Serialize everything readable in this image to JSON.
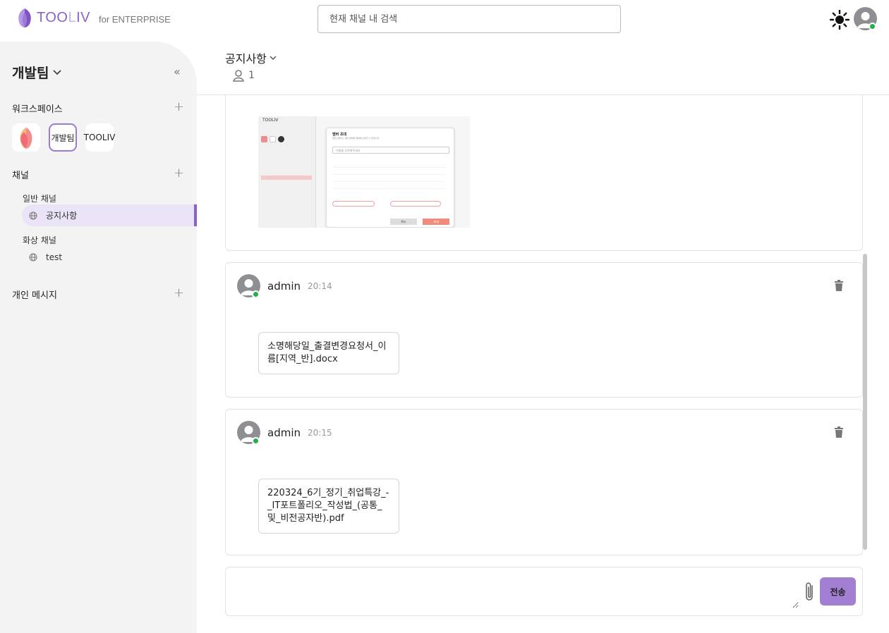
{
  "app": {
    "logo_text_main": "TOO",
    "logo_text_dim": "L",
    "logo_text_end": "IV",
    "logo_sub": "for ENTERPRISE"
  },
  "search": {
    "placeholder": "현재 채널 내 검색"
  },
  "sidebar": {
    "team_name": "개발팀",
    "workspace_label": "워크스페이스",
    "workspaces": [
      {
        "label": ""
      },
      {
        "label": "개발팀"
      },
      {
        "label": "TOOLIV"
      }
    ],
    "channels_label": "채널",
    "general_label": "일반 채널",
    "general_channels": [
      {
        "label": "공지사항"
      }
    ],
    "video_label": "화상 채널",
    "video_channels": [
      {
        "label": "test"
      }
    ],
    "dm_label": "개인 메시지"
  },
  "channel": {
    "title": "공지사항",
    "member_count": "1"
  },
  "mini_screenshot": {
    "app": "TOOLIV",
    "dialog_title": "멤버 초대",
    "dialog_sub": "워크스페이스 내의 멤버를 채널에 초대할 수 있습니다",
    "input_placeholder": "이름을 입력해주세요",
    "cancel": "취소",
    "confirm": "초대"
  },
  "messages": [
    {
      "user": "admin",
      "time": "20:14",
      "file": "소명해당일_출결변경요청서_이름[지역_반].docx"
    },
    {
      "user": "admin",
      "time": "20:15",
      "file": "220324_6기_정기_취업특강_-_IT포트폴리오_작성법_(공통_및_비전공자반).pdf"
    }
  ],
  "composer": {
    "send_label": "전송",
    "placeholder": ""
  },
  "colors": {
    "accent": "#8b63c4",
    "send": "#a37fd4",
    "online": "#23b14d"
  }
}
